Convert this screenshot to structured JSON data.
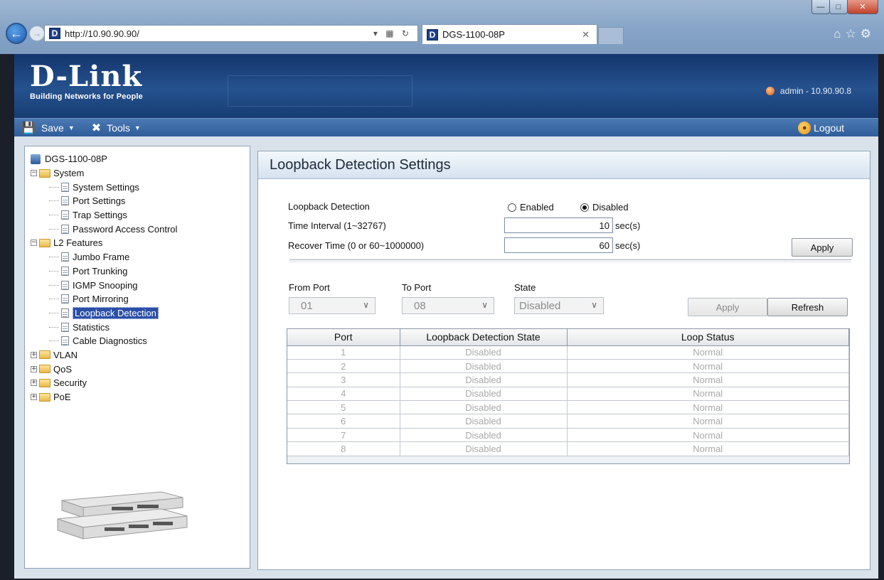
{
  "browser": {
    "url": "http://10.90.90.90/",
    "tab_title": "DGS-1100-08P",
    "favicon_letter": "D",
    "window_controls": [
      "minimize-icon",
      "maximize-icon",
      "close-icon"
    ]
  },
  "header": {
    "logo_name": "D-Link",
    "logo_tagline": "Building Networks for People",
    "user_info": "admin - 10.90.90.8"
  },
  "toolbar": {
    "save_label": "Save",
    "tools_label": "Tools",
    "logout_label": "Logout"
  },
  "tree": {
    "root": "DGS-1100-08P",
    "system": "System",
    "system_items": [
      "System Settings",
      "Port Settings",
      "Trap Settings",
      "Password Access Control"
    ],
    "l2": "L2 Features",
    "l2_items": [
      "Jumbo Frame",
      "Port Trunking",
      "IGMP Snooping",
      "Port Mirroring",
      "Loopback Detection",
      "Statistics",
      "Cable Diagnostics"
    ],
    "others": [
      "VLAN",
      "QoS",
      "Security",
      "PoE"
    ],
    "selected": "Loopback Detection"
  },
  "main": {
    "title": "Loopback Detection Settings",
    "loopback_label": "Loopback Detection",
    "enabled_label": "Enabled",
    "disabled_label": "Disabled",
    "loopback_value": "Disabled",
    "interval_label": "Time Interval (1~32767)",
    "interval_value": "10",
    "recover_label": "Recover Time (0 or 60~1000000)",
    "recover_value": "60",
    "unit": "sec(s)",
    "apply_label": "Apply",
    "from_port_label": "From Port",
    "from_port_value": "01",
    "to_port_label": "To Port",
    "to_port_value": "08",
    "state_label": "State",
    "state_value": "Disabled",
    "apply2_label": "Apply",
    "refresh_label": "Refresh"
  },
  "table": {
    "headers": [
      "Port",
      "Loopback Detection State",
      "Loop Status"
    ],
    "rows": [
      [
        "1",
        "Disabled",
        "Normal"
      ],
      [
        "2",
        "Disabled",
        "Normal"
      ],
      [
        "3",
        "Disabled",
        "Normal"
      ],
      [
        "4",
        "Disabled",
        "Normal"
      ],
      [
        "5",
        "Disabled",
        "Normal"
      ],
      [
        "6",
        "Disabled",
        "Normal"
      ],
      [
        "7",
        "Disabled",
        "Normal"
      ],
      [
        "8",
        "Disabled",
        "Normal"
      ]
    ]
  }
}
